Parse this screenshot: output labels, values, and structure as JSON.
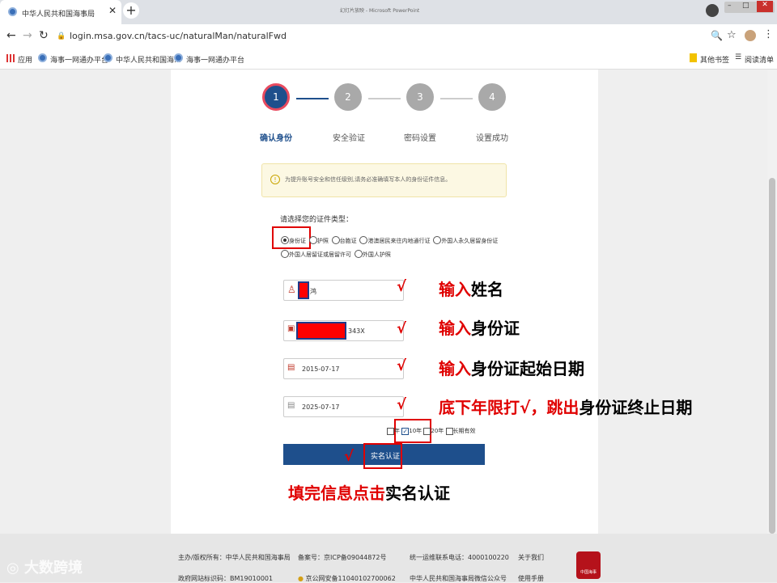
{
  "browser": {
    "tab_title": "中华人民共和国海事局",
    "inactive_tab_title": "幻灯片放映 - Microsoft PowerPoint",
    "url": "login.msa.gov.cn/tacs-uc/naturalMan/naturalFwd",
    "bookmarks": [
      "应用",
      "海事一网通办平台",
      "中华人民共和国海...",
      "海事一网通办平台"
    ],
    "other_bookmarks": "其他书签",
    "reading_list": "阅读清单"
  },
  "steps": [
    {
      "num": "1",
      "label": "确认身份",
      "active": true
    },
    {
      "num": "2",
      "label": "安全验证",
      "active": false
    },
    {
      "num": "3",
      "label": "密码设置",
      "active": false
    },
    {
      "num": "4",
      "label": "设置成功",
      "active": false
    }
  ],
  "notice": "为提升账号安全和信任级别,请务必准确填写本人的身份证件信息。",
  "id_type_label": "请选择您的证件类型：",
  "id_types_row1": [
    "身份证",
    "护照",
    "台胞证",
    "港澳居民来往内地通行证",
    "外国人永久居留身份证"
  ],
  "id_types_row2": [
    "外国人居留证或居留许可",
    "外国人护照"
  ],
  "fields": {
    "name_value": "鸿",
    "id_value": "343X",
    "start_date": "2015-07-17",
    "end_date": "2025-07-17"
  },
  "validity_options": [
    "年",
    "10年",
    "20年",
    "长期有效"
  ],
  "submit_label": "实名认证",
  "annotations": {
    "a1_red": "输入",
    "a1_black": "姓名",
    "a2_red": "输入",
    "a2_black": "身份证",
    "a3_red": "输入",
    "a3_black": "身份证起始日期",
    "a4_red": "底下年限打√，跳出",
    "a4_black": "身份证终止日期",
    "a5_red": "填完信息点击",
    "a5_black": "实名认证",
    "check": "√"
  },
  "footer": {
    "sponsor": "主办/版权所有：中华人民共和国海事局",
    "icp": "备案号：京ICP备09044872号",
    "hotline": "统一运维联系电话：4000100220",
    "about": "关于我们",
    "gov_id": "政府网站标识码：BM19010001",
    "police": "京公网安备11040102700062",
    "wechat": "中华人民共和国海事局微信公众号",
    "manual": "使用手册",
    "logo_text": "中国海事",
    "watermark": "大数跨境"
  },
  "colors": {
    "accent": "#1e4f8c",
    "annotation_red": "#e00000",
    "step_active": "#1e4f8c",
    "step_inactive": "#a9a9a9"
  }
}
